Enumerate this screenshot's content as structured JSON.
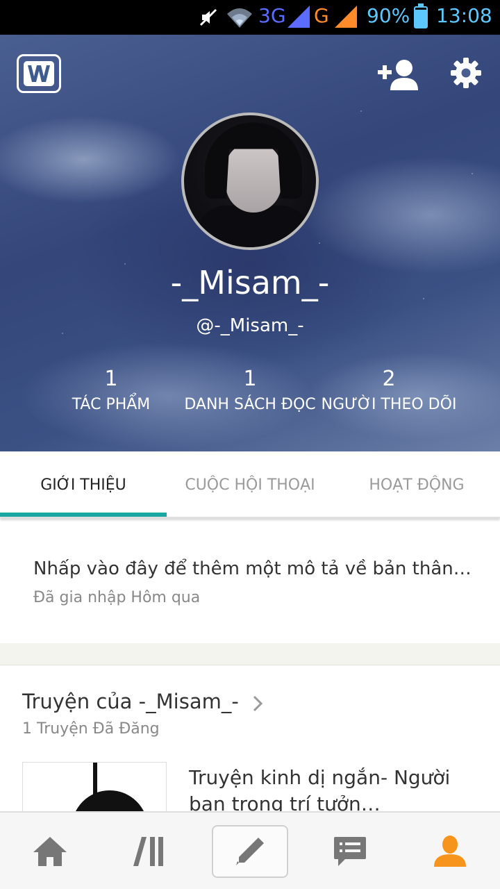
{
  "status_bar": {
    "network_1": "3G",
    "network_2": "G",
    "battery": "90%",
    "time": "13:08",
    "icons": [
      "mute-icon",
      "wifi-icon",
      "signal-icon",
      "signal-icon",
      "battery-icon"
    ]
  },
  "header": {
    "logo_icon": "wattpad-logo-icon",
    "add_user_icon": "add-user-icon",
    "settings_icon": "gear-icon",
    "display_name": "-_Misam_-",
    "handle": "@-_Misam_-",
    "stats": [
      {
        "value": "1",
        "label": "TÁC PHẨM"
      },
      {
        "value": "1",
        "label": "DANH SÁCH ĐỌC"
      },
      {
        "value": "2",
        "label": "NGƯỜI THEO DÕI"
      }
    ]
  },
  "tabs": [
    {
      "label": "GIỚI THIỆU",
      "active": true
    },
    {
      "label": "CUỘC HỘI THOẠI",
      "active": false
    },
    {
      "label": "HOẠT ĐỘNG",
      "active": false
    }
  ],
  "about": {
    "description_placeholder": "Nhấp vào đây để thêm một mô tả về bản thân…",
    "joined": "Đã gia nhập Hôm qua"
  },
  "stories": {
    "title": "Truyện của -_Misam_-",
    "count": "1 Truyện Đã Đăng",
    "items": [
      {
        "title": "Truyện kinh dị ngắn- Người bạn trong trí tưởn…"
      }
    ]
  },
  "bottom_nav": [
    {
      "icon": "home-icon"
    },
    {
      "icon": "library-icon"
    },
    {
      "icon": "pencil-icon"
    },
    {
      "icon": "messages-icon"
    },
    {
      "icon": "profile-icon"
    }
  ],
  "colors": {
    "accent": "#18a7a3",
    "profile_active": "#f7941d",
    "icon_gray": "#777777"
  }
}
